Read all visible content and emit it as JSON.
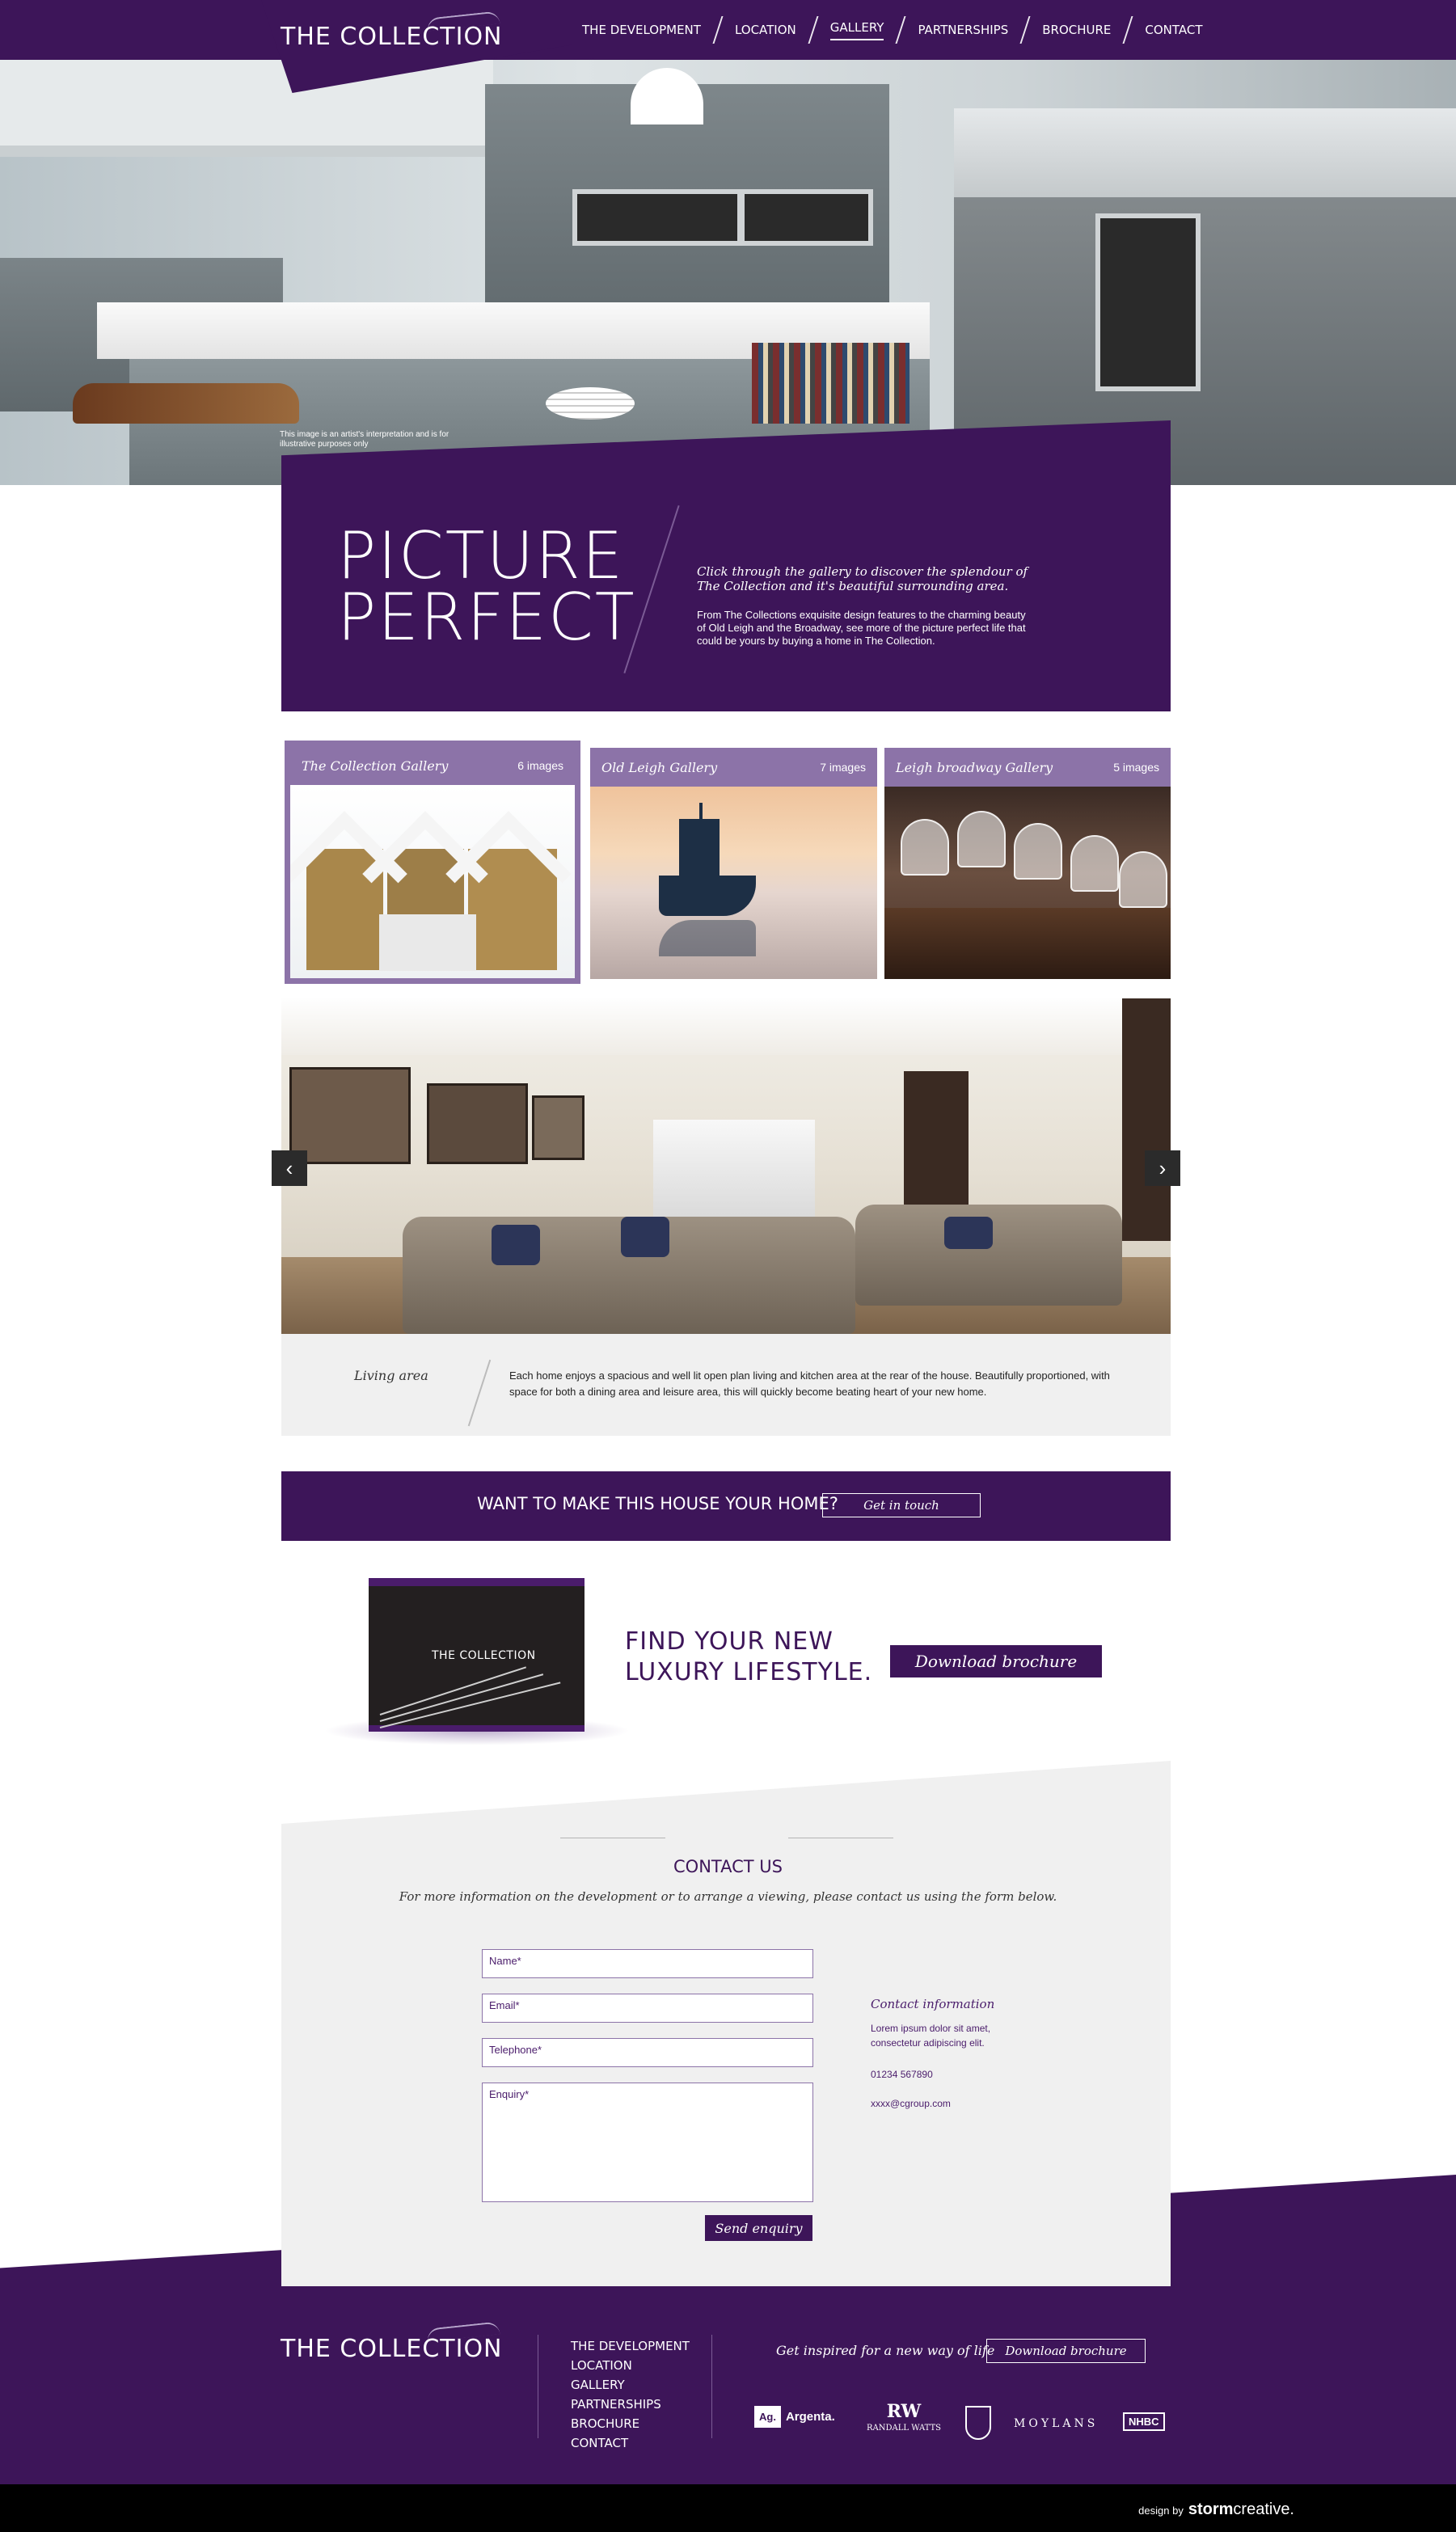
{
  "brand": {
    "logo": "THE COLLECTION"
  },
  "nav": {
    "items": [
      {
        "label": "THE DEVELOPMENT"
      },
      {
        "label": "LOCATION"
      },
      {
        "label": "GALLERY"
      },
      {
        "label": "PARTNERSHIPS"
      },
      {
        "label": "BROCHURE"
      },
      {
        "label": "CONTACT"
      }
    ],
    "active": "GALLERY"
  },
  "hero": {
    "caption": "This image is an artist's interpretation and is for illustrative purposes only"
  },
  "intro": {
    "title_line1": "PICTURE",
    "title_line2": "PERFECT",
    "lead": "Click through the gallery to discover the splendour of The Collection and it's beautiful surrounding area.",
    "body": "From The Collections exquisite design features to the charming beauty of Old Leigh and the Broadway, see more of the picture perfect life that could be yours by buying a home in The Collection."
  },
  "galleries": [
    {
      "title": "The Collection Gallery",
      "count": "6 images"
    },
    {
      "title": "Old Leigh Gallery",
      "count": "7 images"
    },
    {
      "title": "Leigh broadway Gallery",
      "count": "5 images"
    }
  ],
  "slider": {
    "prev": "‹",
    "next": "›",
    "caption_title": "Living area",
    "caption_text": "Each home enjoys a spacious and well lit open plan living and kitchen area at the rear of the house. Beautifully proportioned, with space for both a dining area and leisure area, this will quickly become beating heart of your new home."
  },
  "cta": {
    "text": "WANT TO MAKE THIS HOUSE YOUR HOME?",
    "button": "Get in touch"
  },
  "brochure": {
    "book_logo": "THE COLLECTION",
    "title_line1": "FIND YOUR NEW",
    "title_line2": "LUXURY LIFESTYLE.",
    "button": "Download brochure"
  },
  "contact": {
    "title": "CONTACT US",
    "subtitle": "For more information on the development or to arrange a viewing, please contact us using the form below.",
    "fields": {
      "name": "Name*",
      "email": "Email*",
      "telephone": "Telephone*",
      "enquiry": "Enquiry*"
    },
    "send": "Send enquiry",
    "info_title": "Contact information",
    "info_text": "Lorem ipsum dolor sit amet, consectetur adipiscing elit.",
    "phone": "01234 567890",
    "email": "xxxx@cgroup.com"
  },
  "footer": {
    "logo": "THE COLLECTION",
    "nav": [
      "THE DEVELOPMENT",
      "LOCATION",
      "GALLERY",
      "PARTNERSHIPS",
      "BROCHURE",
      "CONTACT"
    ],
    "tagline": "Get inspired for a new way of life",
    "download": "Download brochure",
    "partners": {
      "argenta_mark": "Ag.",
      "argenta": "Argenta.",
      "randall_mark": "RW",
      "randall": "RANDALL WATTS",
      "moylans": "MOYLANS",
      "nhbc": "NHBC"
    }
  },
  "credit": {
    "prefix": "design by",
    "brand_bold": "storm",
    "brand_rest": "creative."
  }
}
